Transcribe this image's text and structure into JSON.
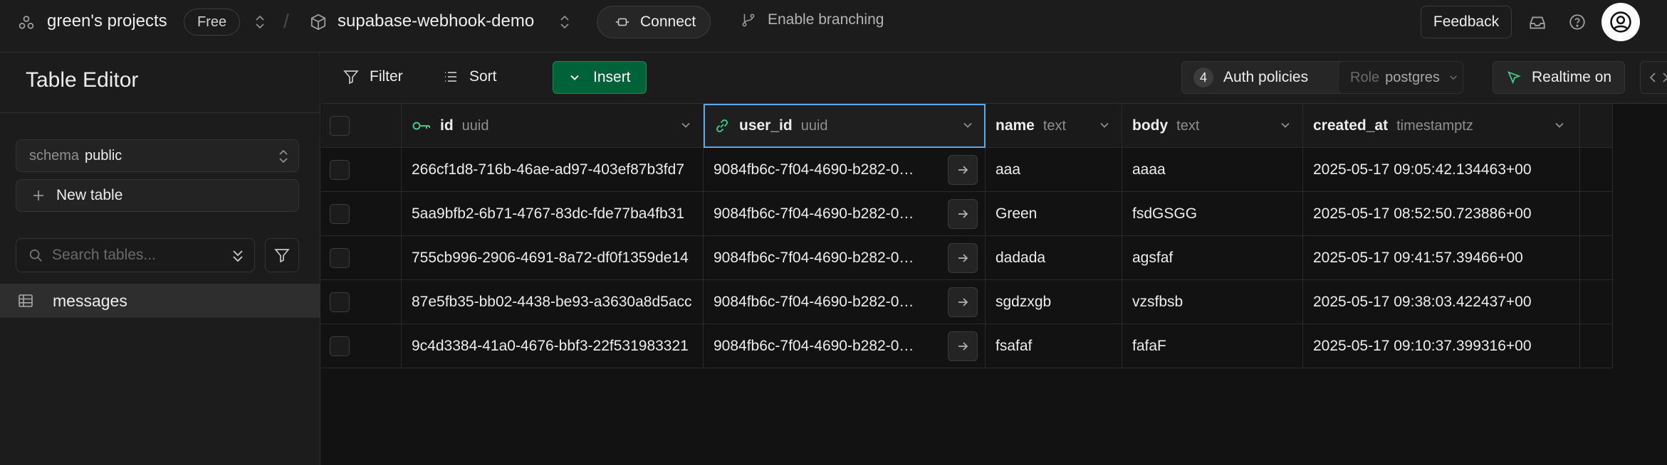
{
  "header": {
    "org_name": "green's projects",
    "plan_badge": "Free",
    "separator": "/",
    "project_name": "supabase-webhook-demo",
    "connect_label": "Connect",
    "branching_label": "Enable branching",
    "feedback_label": "Feedback"
  },
  "sidebar": {
    "title": "Table Editor",
    "schema_label": "schema",
    "schema_value": "public",
    "new_table_label": "New table",
    "search_placeholder": "Search tables...",
    "tables": [
      {
        "label": "messages",
        "active": true
      }
    ]
  },
  "toolbar": {
    "filter_label": "Filter",
    "sort_label": "Sort",
    "insert_label": "Insert",
    "auth_count": "4",
    "auth_label": "Auth policies",
    "role_label": "Role",
    "role_value": "postgres",
    "realtime_label": "Realtime on"
  },
  "grid": {
    "columns": [
      {
        "name": "id",
        "type": "uuid",
        "icon": "key-icon"
      },
      {
        "name": "user_id",
        "type": "uuid",
        "icon": "link-icon"
      },
      {
        "name": "name",
        "type": "text"
      },
      {
        "name": "body",
        "type": "text"
      },
      {
        "name": "created_at",
        "type": "timestamptz"
      }
    ],
    "rows": [
      {
        "id": "266cf1d8-716b-46ae-ad97-403ef87b3fd7",
        "user_id": "9084fb6c-7f04-4690-b282-0…",
        "name": "aaa",
        "body": "aaaa",
        "created_at": "2025-05-17 09:05:42.134463+00"
      },
      {
        "id": "5aa9bfb2-6b71-4767-83dc-fde77ba4fb31",
        "user_id": "9084fb6c-7f04-4690-b282-0…",
        "name": "Green",
        "body": "fsdGSGG",
        "created_at": "2025-05-17 08:52:50.723886+00"
      },
      {
        "id": "755cb996-2906-4691-8a72-df0f1359de14",
        "user_id": "9084fb6c-7f04-4690-b282-0…",
        "name": "dadada",
        "body": "agsfaf",
        "created_at": "2025-05-17 09:41:57.39466+00"
      },
      {
        "id": "87e5fb35-bb02-4438-be93-a3630a8d5acc",
        "user_id": "9084fb6c-7f04-4690-b282-0…",
        "name": "sgdzxgb",
        "body": "vzsfbsb",
        "created_at": "2025-05-17 09:38:03.422437+00"
      },
      {
        "id": "9c4d3384-41a0-4676-bbf3-22f531983321",
        "user_id": "9084fb6c-7f04-4690-b282-0…",
        "name": "fsafaf",
        "body": "fafaF",
        "created_at": "2025-05-17 09:10:37.399316+00"
      }
    ]
  },
  "colors": {
    "background": "#121212",
    "panel": "#1c1c1c",
    "brand_green": "#006239",
    "key_green": "#3ecf8e",
    "selection_blue": "#5fa8e8"
  }
}
